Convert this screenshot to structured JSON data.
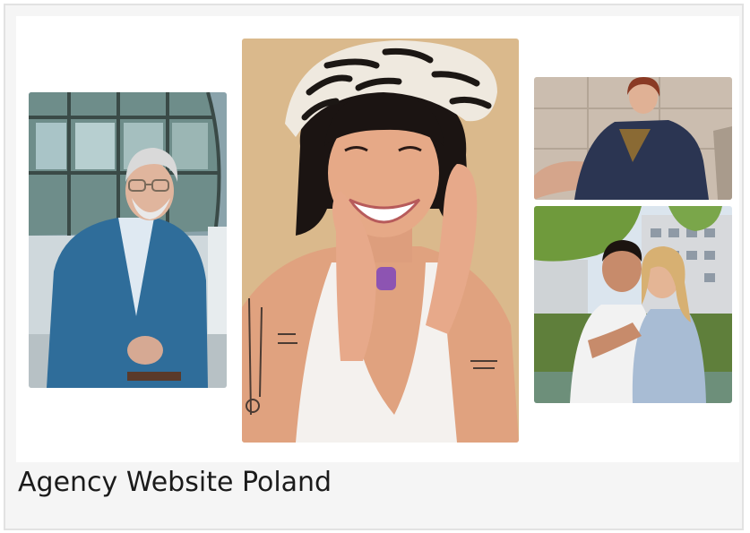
{
  "card": {
    "title": "Agency Website Poland"
  },
  "gallery": {
    "images": [
      {
        "subject": "man-in-blue-suit-photo"
      },
      {
        "subject": "smiling-woman-zebra-beret-photo"
      },
      {
        "subject": "woman-sitting-striped-suit-photo"
      },
      {
        "subject": "couple-embracing-photo"
      }
    ]
  },
  "colors": {
    "card_background": "#f5f5f5",
    "card_border": "#e2e2e2",
    "preview_background": "#ffffff",
    "caption_text": "#1b1b1b"
  }
}
